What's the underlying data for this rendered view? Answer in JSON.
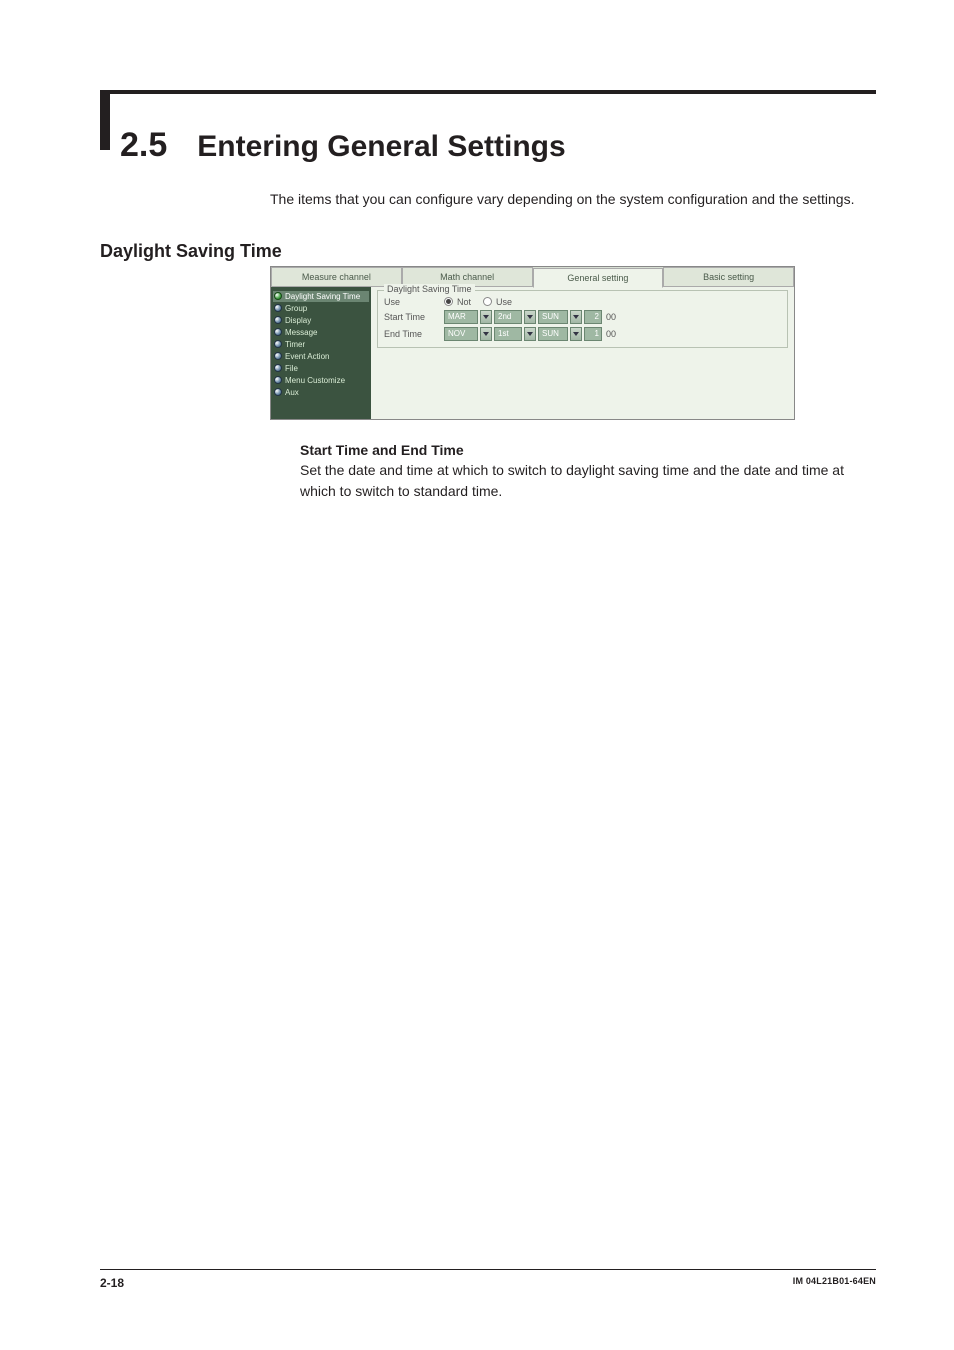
{
  "section": {
    "number": "2.5",
    "title": "Entering General Settings"
  },
  "intro": "The items that you can configure vary depending on the system configuration and the settings.",
  "h2": "Daylight Saving Time",
  "tabs": [
    "Measure channel",
    "Math channel",
    "General setting",
    "Basic setting"
  ],
  "sidebar": {
    "items": [
      "Daylight Saving Time",
      "Group",
      "Display",
      "Message",
      "Timer",
      "Event Action",
      "File",
      "Menu Customize",
      "Aux"
    ]
  },
  "panel": {
    "legend": "Daylight Saving Time",
    "use_label": "Use",
    "radio_not": "Not",
    "radio_use": "Use",
    "start_label": "Start Time",
    "end_label": "End Time",
    "start_row": {
      "month": "MAR",
      "week": "2nd",
      "day": "SUN",
      "hour": "2",
      "min": "00"
    },
    "end_row": {
      "month": "NOV",
      "week": "1st",
      "day": "SUN",
      "hour": "1",
      "min": "00"
    }
  },
  "h3": "Start Time and End Time",
  "body": "Set the date and time at which to switch to daylight saving time and the date and time at which to switch to standard time.",
  "footer": {
    "left": "2-18",
    "right": "IM 04L21B01-64EN"
  }
}
